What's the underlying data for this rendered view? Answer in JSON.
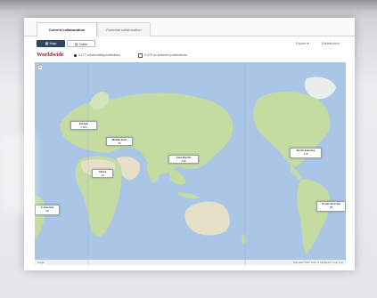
{
  "tabs": [
    {
      "label": "Current collaboration",
      "active": true
    },
    {
      "label": "Potential collaboration",
      "active": false
    }
  ],
  "toolbar": {
    "map_label": "Map",
    "table_label": "Table",
    "export_label": "Export ▾",
    "distribution_label": "Distribution"
  },
  "heading": "Worldwide",
  "legend": {
    "institutions": "2,177 collaborating institutions",
    "publications": "5,075 co-authored publications"
  },
  "map": {
    "zoom_label": "+",
    "footer_left": "Google",
    "footer_right": "Map data ©2015  Terms of Use  Report a map error"
  },
  "regions": [
    {
      "key": "europe",
      "name": "Europe",
      "value": "1,822"
    },
    {
      "key": "middle-east",
      "name": "Middle East",
      "value": "36"
    },
    {
      "key": "africa",
      "name": "Africa",
      "value": "24"
    },
    {
      "key": "asia-pacific",
      "name": "Asia Pacific",
      "value": "248"
    },
    {
      "key": "north-america",
      "name": "North America",
      "value": "478"
    },
    {
      "key": "south-america-left",
      "name": "h America",
      "value": "28"
    },
    {
      "key": "south-america",
      "name": "South America",
      "value": "28"
    }
  ],
  "colors": {
    "heading": "#9b1c2e",
    "map_button": "#2f4565",
    "ocean": "#a9c6e7",
    "land": "#c4dba2",
    "desert": "#e7e0c6"
  }
}
